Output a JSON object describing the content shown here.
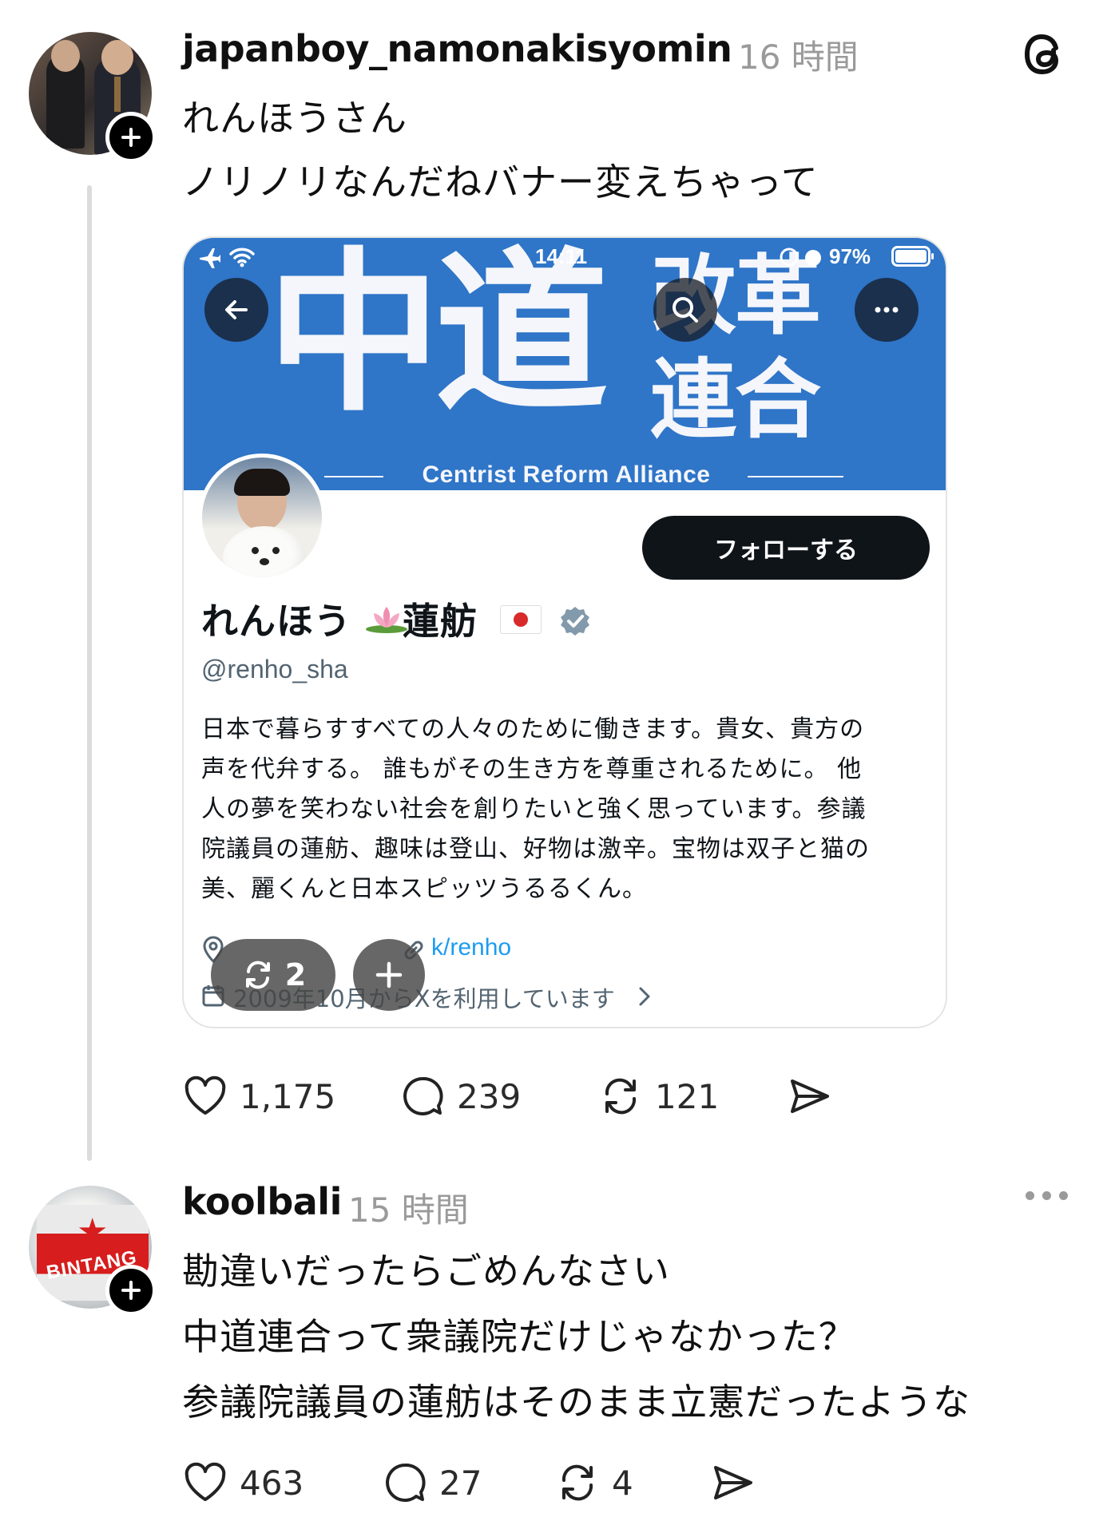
{
  "post1": {
    "username": "japanboy_namonakisyomin",
    "time": "16 時間",
    "lines": [
      "れんほうさん",
      "ノリノリなんだねバナー変えちゃって"
    ],
    "embedded": {
      "status_time": "14:11",
      "battery": "97%",
      "banner_big": "中道",
      "banner_small1": "改革",
      "banner_small2": "連合",
      "banner_en": "Centrist Reform Alliance",
      "follow_label": "フォローする",
      "display_name_a": "れんほう",
      "display_name_b": "蓮舫",
      "handle": "@renho_sha",
      "bio": [
        "日本で暮らすすべての人々のために働きます。貴女、貴方の",
        "声を代弁する。 誰もがその生き方を尊重されるために。 他",
        "人の夢を笑わない社会を創りたいと強く思っています。参議",
        "院議員の蓮舫、趣味は登山、好物は激辛。宝物は双子と猫の",
        "美、麗くんと日本スピッツうるるくん。"
      ],
      "link_text": "k/renho",
      "joined_text": "2009年10月からXを利用しています",
      "overlay_count": "2"
    },
    "actions": {
      "likes": "1,175",
      "replies": "239",
      "reposts": "121"
    }
  },
  "post2": {
    "username": "koolbali",
    "time": "15 時間",
    "avatar_brand": "BINTANG",
    "lines": [
      "勘違いだったらごめんなさい",
      "中道連合って衆議院だけじゃなかった？",
      "参議院議員の蓮舫はそのまま立憲だったような"
    ],
    "actions": {
      "likes": "463",
      "replies": "27",
      "reposts": "4"
    }
  },
  "colors": {
    "banner": "#2f75c8",
    "follow_button": "#0f1419",
    "verified": "#829aab",
    "link": "#1d9bf0"
  }
}
